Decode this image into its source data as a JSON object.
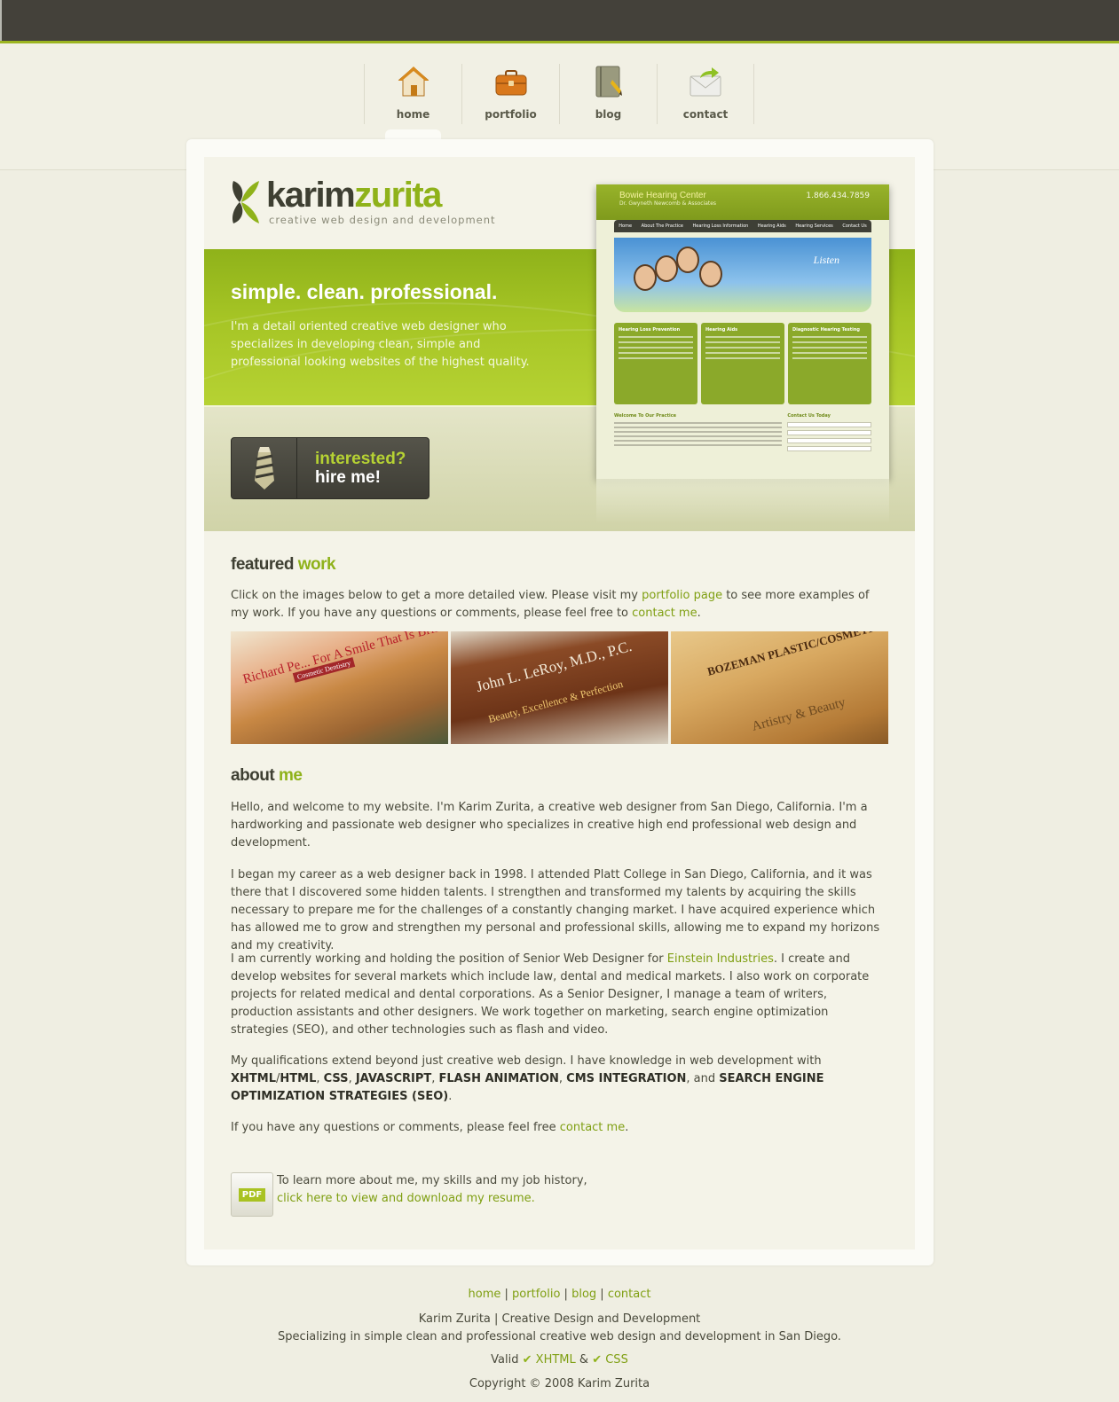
{
  "colors": {
    "accent": "#8fb21a",
    "dark": "#44413a",
    "link": "#7f9f12"
  },
  "nav": {
    "items": [
      {
        "label": "home",
        "icon": "house-icon"
      },
      {
        "label": "portfolio",
        "icon": "briefcase-icon"
      },
      {
        "label": "blog",
        "icon": "notebook-icon"
      },
      {
        "label": "contact",
        "icon": "envelope-icon"
      }
    ]
  },
  "logo": {
    "first": "karim",
    "last": "zurita",
    "tagline": "creative web design and development"
  },
  "hero": {
    "title": "simple. clean. professional.",
    "text": "I'm a detail oriented creative web designer who specializes in developing clean, simple and professional looking websites of the highest quality.",
    "hire_line1": "interested?",
    "hire_line2": "hire me!"
  },
  "screenshot": {
    "title": "Bowie Hearing Center",
    "subtitle": "Dr. Gwyneth Newcomb & Associates",
    "phone": "1.866.434.7859",
    "nav": [
      "Home",
      "About The Practice",
      "Hearing Loss Information",
      "Hearing Aids",
      "Hearing Services",
      "Contact Us"
    ],
    "hero_text": "Listen",
    "cols": [
      "Hearing Loss Prevention",
      "Hearing Aids",
      "Diagnostic Hearing Testing"
    ],
    "welcome": "Welcome To Our Practice",
    "contact": "Contact Us Today"
  },
  "featured": {
    "heading_a": "featured",
    "heading_b": "work",
    "text_1": "Click on the images below to get a more detailed view. Please visit my ",
    "link_1": "portfolio page",
    "text_2": " to see more examples of my work. If you have any questions or comments, please feel free to ",
    "link_2": "contact me",
    "text_3": ".",
    "thumbs": [
      {
        "caption": "Richard Pe... For A Smile That Is Brilliant",
        "caption2": "Cosmetic Dentistry"
      },
      {
        "caption": "John L. LeRoy, M.D., P.C.",
        "caption2": "Beauty, Excellence & Perfection"
      },
      {
        "caption": "BOZEMAN PLASTIC/COSMETIC",
        "caption2": "Artistry & Beauty"
      }
    ]
  },
  "about": {
    "heading_a": "about",
    "heading_b": "me",
    "p1": "Hello, and welcome to my website. I'm Karim Zurita, a creative web designer from San Diego, California. I'm a hardworking and passionate web designer who specializes in creative high end professional web design and development.",
    "p2": "I began my career as a web designer back in 1998. I attended Platt College in San Diego, California, and it was there that I discovered some hidden talents. I strengthen and transformed my talents by acquiring the skills necessary to prepare me for the challenges of a constantly changing market. I have acquired experience which has allowed me to grow and strengthen my personal and professional skills, allowing me to expand my horizons and my creativity.",
    "p3_a": "I am currently working and holding the position of Senior Web Designer for ",
    "p3_link": "Einstein Industries",
    "p3_b": ". I create and develop websites for several markets which include law, dental and medical markets. I also work on corporate projects for related medical and dental corporations. As a Senior Designer, I manage a team of writers, production assistants and other designers. We work together on marketing, search engine optimization strategies (SEO), and other technologies such as flash and video.",
    "p4_a": "My qualifications extend beyond just creative web design. I have knowledge in web development with ",
    "skill_1": "XHTML",
    "slash": "/",
    "skill_2": "HTML",
    "comma": ", ",
    "skill_3": "CSS",
    "skill_4": "JAVASCRIPT",
    "skill_5": "FLASH ANIMATION",
    "skill_6": "CMS INTEGRATION",
    "and": ", and ",
    "skill_7": "SEARCH ENGINE OPTIMIZATION STRATEGIES (SEO)",
    "period": ".",
    "p5_a": "If you have any questions or comments, please feel free ",
    "p5_link": "contact me",
    "p5_b": "."
  },
  "resume": {
    "badge": "PDF",
    "line1": "To learn more about me, my skills and my job history,",
    "link": "click here to view and download my resume."
  },
  "footer": {
    "links": [
      "home",
      "portfolio",
      "blog",
      "contact"
    ],
    "sep": "|",
    "line1": "Karim Zurita | Creative Design and Development",
    "line2": "Specializing in simple clean and professional creative web design and development in San Diego.",
    "valid": "Valid",
    "xhtml": "XHTML",
    "amp": "&",
    "css": "CSS",
    "copyright": "Copyright © 2008 Karim Zurita"
  }
}
